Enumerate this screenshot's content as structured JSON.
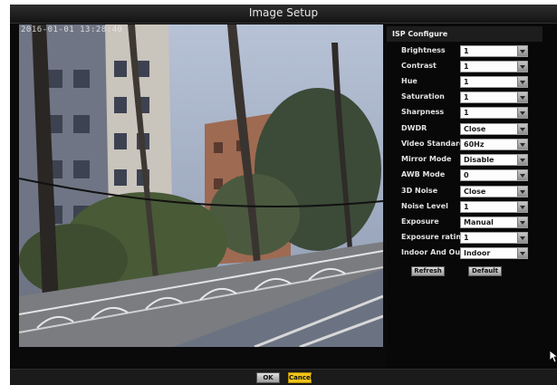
{
  "window": {
    "title": "Image Setup"
  },
  "preview": {
    "timestamp": "2016-01-01 13:28:40"
  },
  "isp": {
    "heading": "ISP Configure",
    "settings": [
      {
        "label": "Brightness",
        "value": "1"
      },
      {
        "label": "Contrast",
        "value": "1"
      },
      {
        "label": "Hue",
        "value": "1"
      },
      {
        "label": "Saturation",
        "value": "1"
      },
      {
        "label": "Sharpness",
        "value": "1"
      },
      {
        "label": "DWDR",
        "value": "Close"
      },
      {
        "label": "Video Standard",
        "value": "60Hz"
      },
      {
        "label": "Mirror Mode",
        "value": "Disable"
      },
      {
        "label": "AWB Mode",
        "value": "0"
      },
      {
        "label": "3D Noise",
        "value": "Close"
      },
      {
        "label": "Noise Level",
        "value": "1"
      },
      {
        "label": "Exposure",
        "value": "Manual"
      },
      {
        "label": "Exposure rating",
        "value": "1"
      },
      {
        "label": "Indoor And Outdoor",
        "value": "Indoor"
      }
    ],
    "refresh_label": "Refresh",
    "default_label": "Default"
  },
  "footer": {
    "ok_label": "OK",
    "cancel_label": "Cancel"
  },
  "colors": {
    "cancel_accent": "#f0c419",
    "window_bg": "#0a0a0a"
  },
  "icons": {
    "dropdown": "chevron-down-icon",
    "cursor": "mouse-pointer-icon"
  }
}
